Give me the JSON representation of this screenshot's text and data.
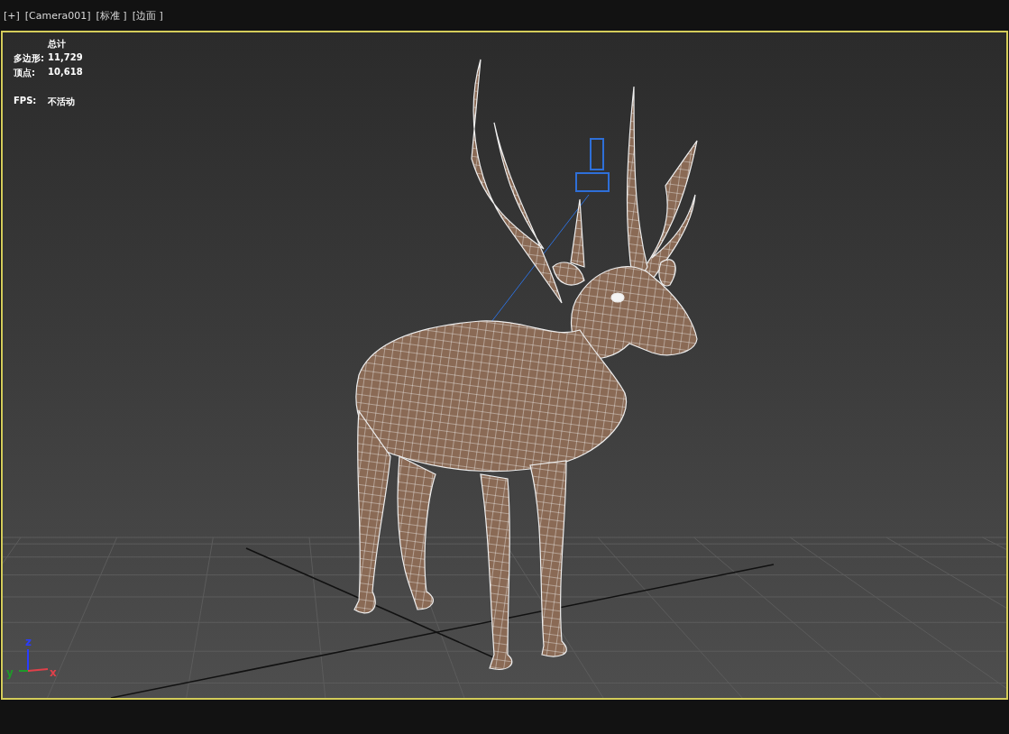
{
  "viewport_labels": [
    "[+]",
    "[Camera001]",
    "[标准 ]",
    "[边面 ]"
  ],
  "stats": {
    "heading": "总计",
    "rows": [
      {
        "label": "多边形:",
        "value": "11,729"
      },
      {
        "label": "顶点:",
        "value": "10,618"
      }
    ],
    "fps": {
      "label": "FPS:",
      "value": "不活动"
    }
  },
  "axes": [
    {
      "label": "z",
      "color": "#2a3cff"
    },
    {
      "label": "y",
      "color": "#1f9a2a"
    },
    {
      "label": "x",
      "color": "#e0404a"
    }
  ]
}
